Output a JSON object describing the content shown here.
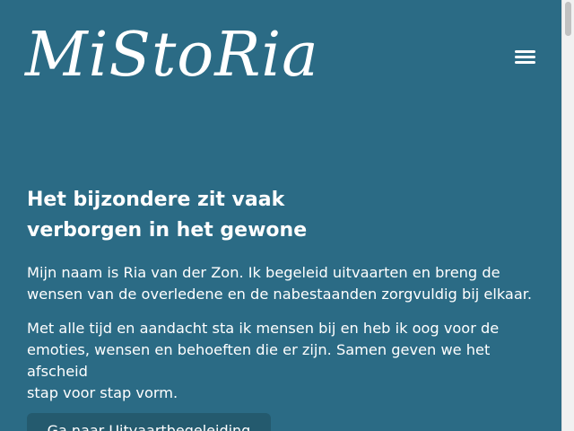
{
  "header": {
    "logo_text": "MiStoRia",
    "menu_icon": "hamburger-menu-icon"
  },
  "main": {
    "heading_line1": "Het bijzondere zit vaak",
    "heading_line2": "verborgen in het gewone",
    "paragraph1_line1": "Mijn naam is Ria van der Zon. Ik begeleid uitvaarten en breng de",
    "paragraph1_line2": "wensen van de overledene en de nabestaanden zorgvuldig bij elkaar.",
    "paragraph2_line1": "Met alle tijd en aandacht sta ik mensen bij en heb ik oog voor de",
    "paragraph2_line2": "emoties, wensen en behoeften die er zijn. Samen geven we het afscheid",
    "paragraph2_line3": "stap voor stap vorm.",
    "cta_label": "Ga naar Uitvaartbegeleiding"
  },
  "colors": {
    "background": "#2b6b85",
    "button": "#245a6e",
    "text": "#ffffff"
  }
}
